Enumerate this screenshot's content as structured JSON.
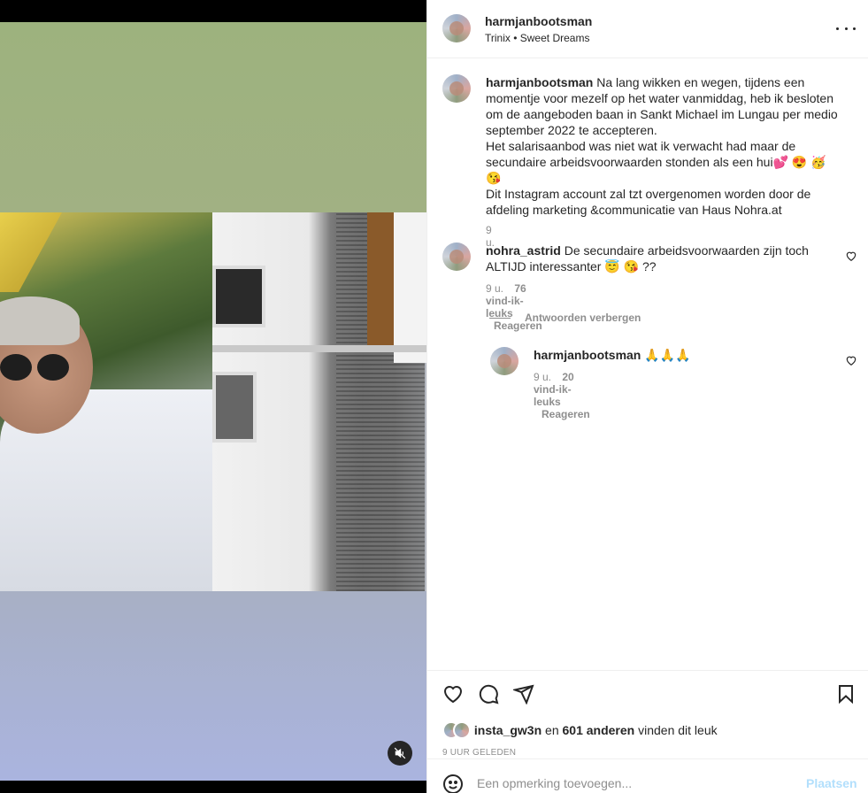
{
  "post": {
    "username": "harmjanbootsman",
    "music": "Trinix • Sweet Dreams",
    "more_icon": "more-horizontal-icon"
  },
  "caption": {
    "username": "harmjanbootsman",
    "lines": [
      "Na lang wikken en wegen, tijdens een",
      "momentje voor mezelf op het water vanmiddag, heb ik besloten",
      "om de aangeboden baan in Sankt Michael im Lungau per medio",
      "september 2022 te accepteren.",
      "Het salarisaanbod was niet wat ik verwacht had maar de",
      "secundaire arbeidsvoorwaarden stonden als een hui💕 😍 🥳 😘",
      "Dit Instagram account zal tzt overgenomen worden door de",
      "afdeling marketing &communicatie van Haus Nohra.at"
    ],
    "time": "9 u."
  },
  "comments": [
    {
      "username": "nohra_astrid",
      "lines": [
        "De secundaire arbeidsvoorwaarden zijn toch",
        "ALTIJD interessanter 😇 😘 ??"
      ],
      "time": "9 u.",
      "likes": "76 vind-ik-leuks",
      "reply": "Reageren"
    }
  ],
  "hide_replies": "Antwoorden verbergen",
  "replies": [
    {
      "username": "harmjanbootsman",
      "text": "🙏🙏🙏",
      "time": "9 u.",
      "likes": "20 vind-ik-leuks",
      "reply": "Reageren"
    }
  ],
  "likes": {
    "user": "insta_gw3n",
    "connector": "en",
    "others": "601 anderen",
    "suffix": "vinden dit leuk"
  },
  "timestamp": "9 UUR GELEDEN",
  "add_comment": {
    "placeholder": "Een opmerking toevoegen...",
    "post_label": "Plaatsen"
  },
  "colors": {
    "text": "#262626",
    "muted": "#8e8e8e",
    "post_disabled": "#b2dffc",
    "border": "#efefef"
  }
}
